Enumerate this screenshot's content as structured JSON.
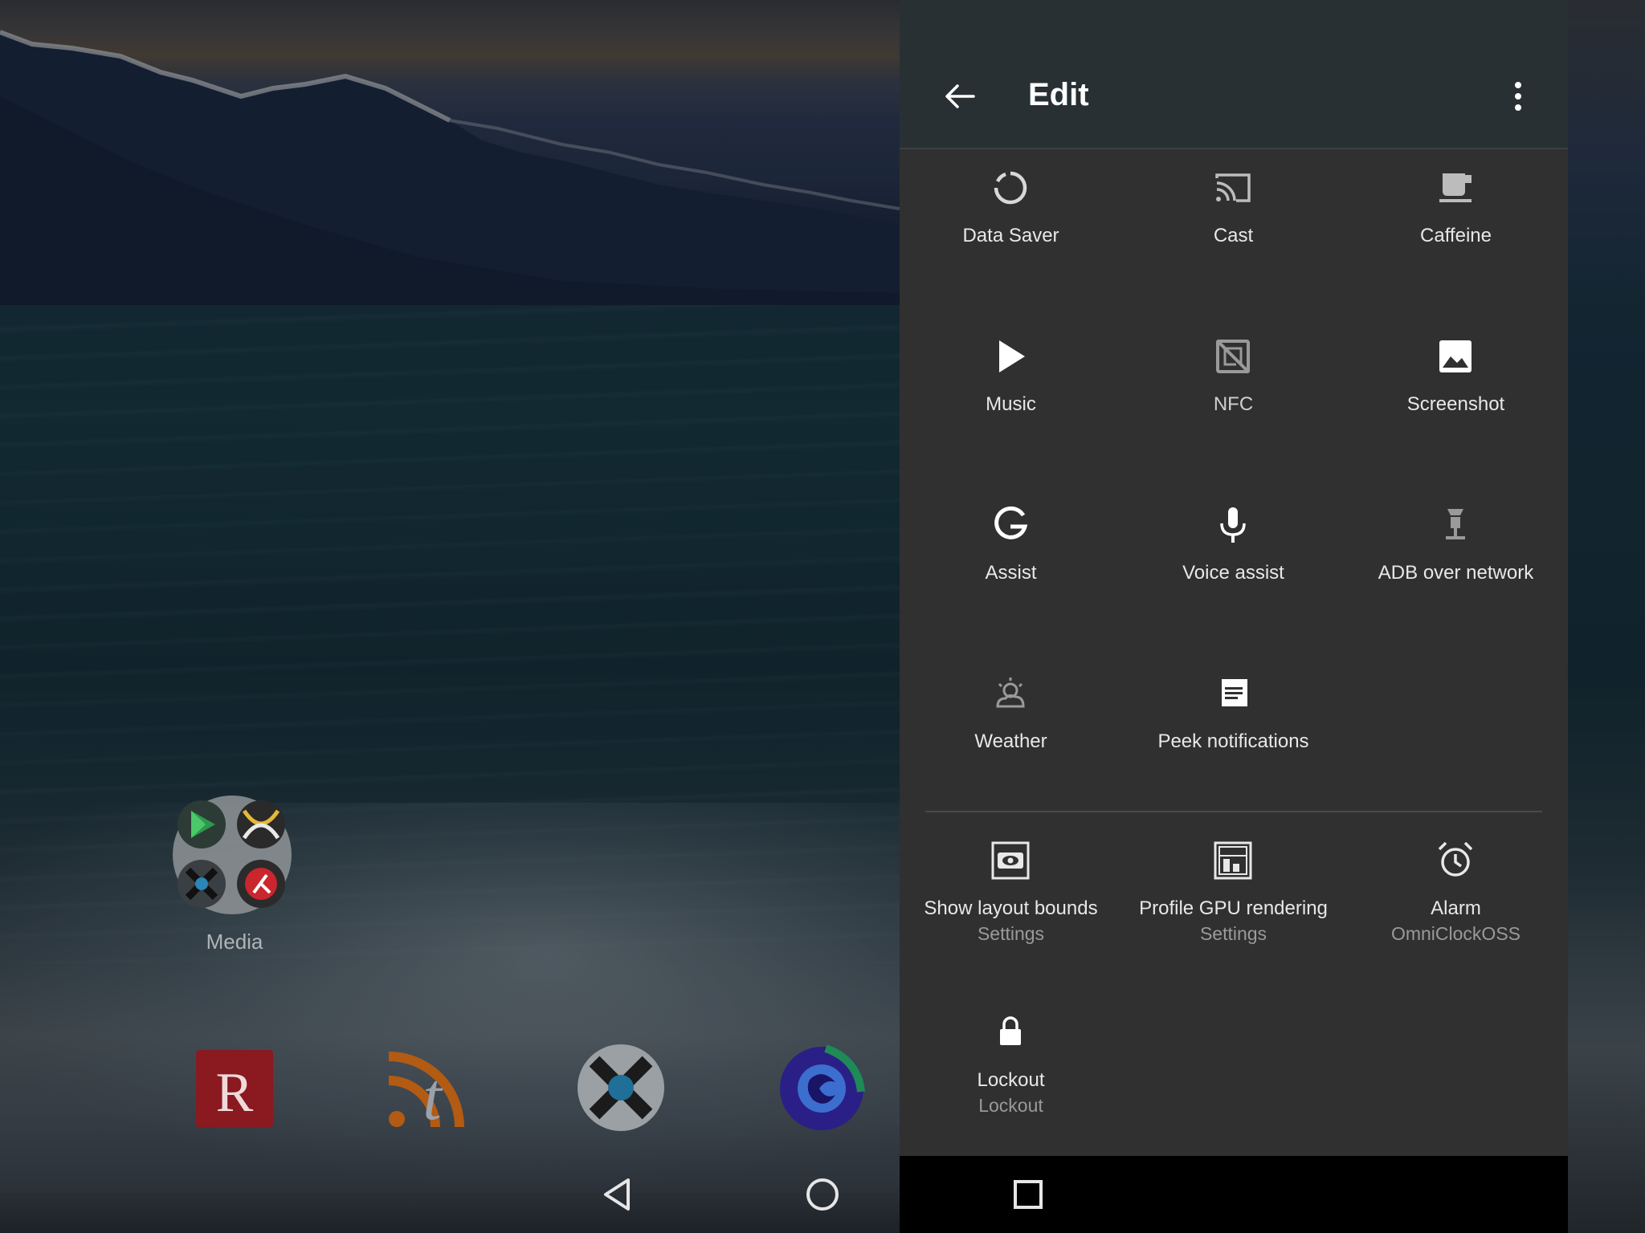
{
  "home": {
    "folder": {
      "label": "Media",
      "icons": [
        "play-store-icon",
        "podcast-icon",
        "sonos-icon",
        "remote-icon"
      ]
    },
    "dock": [
      {
        "name": "reddit-app-icon",
        "letter": "R",
        "color": "#a3161f"
      },
      {
        "name": "tumblr-rss-app-icon",
        "letter": "t",
        "color": "#c26a1f"
      },
      {
        "name": "sonos-app-icon",
        "color": "#2a86b6"
      },
      {
        "name": "firefox-app-icon",
        "color": "#3e2aa8"
      }
    ]
  },
  "edit_panel": {
    "title": "Edit",
    "colors": {
      "toolbar": "#283034",
      "panel": "#303030",
      "accent": "#ffffff"
    },
    "tiles": [
      {
        "label": "Data Saver",
        "icon": "data-saver-icon"
      },
      {
        "label": "Cast",
        "icon": "cast-icon"
      },
      {
        "label": "Caffeine",
        "icon": "coffee-cup-icon"
      },
      {
        "label": "Music",
        "icon": "play-icon"
      },
      {
        "label": "NFC",
        "icon": "nfc-icon"
      },
      {
        "label": "Screenshot",
        "icon": "image-icon"
      },
      {
        "label": "Assist",
        "icon": "google-g-icon"
      },
      {
        "label": "Voice assist",
        "icon": "microphone-icon"
      },
      {
        "label": "ADB over network",
        "icon": "adb-icon"
      },
      {
        "label": "Weather",
        "icon": "weather-icon"
      },
      {
        "label": "Peek notifications",
        "icon": "peek-notifications-icon"
      }
    ],
    "available_tiles": [
      {
        "label": "Show layout bounds",
        "sublabel": "Settings",
        "icon": "layout-bounds-icon"
      },
      {
        "label": "Profile GPU rendering",
        "sublabel": "Settings",
        "icon": "gpu-profile-icon"
      },
      {
        "label": "Alarm",
        "sublabel": "OmniClockOSS",
        "icon": "alarm-clock-icon"
      },
      {
        "label": "Lockout",
        "sublabel": "Lockout",
        "icon": "lock-icon"
      }
    ]
  },
  "navbar": [
    "back-nav-icon",
    "home-nav-icon",
    "recents-nav-icon"
  ]
}
